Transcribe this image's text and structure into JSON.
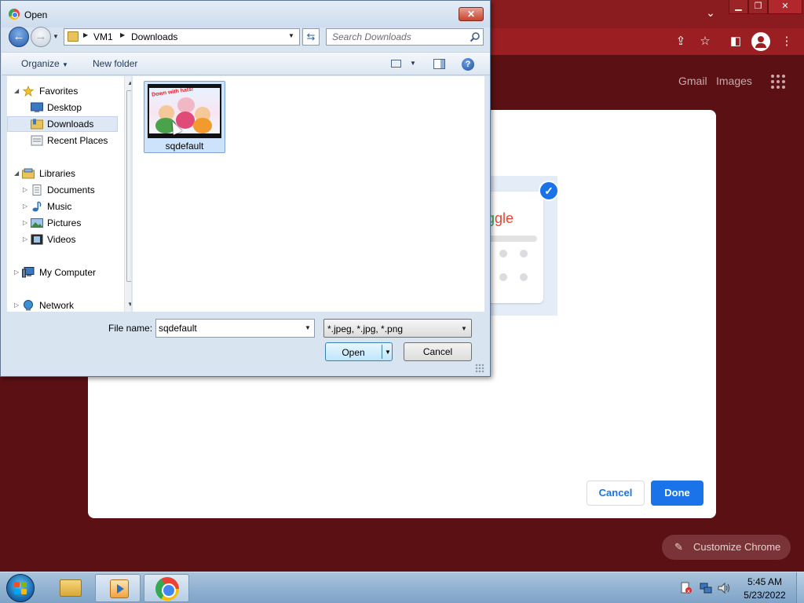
{
  "chrome": {
    "top_links": [
      "Gmail",
      "Images"
    ],
    "customize_button": "Customize Chrome"
  },
  "customize_dialog": {
    "logo_text": "gle",
    "cancel_label": "Cancel",
    "done_label": "Done"
  },
  "open_dialog": {
    "title": "Open",
    "breadcrumb": [
      "VM1",
      "Downloads"
    ],
    "search": {
      "placeholder": "Search Downloads"
    },
    "toolbar": {
      "organize": "Organize",
      "new_folder": "New folder"
    },
    "nav": {
      "items": [
        {
          "label": "Favorites",
          "icon": "star-icon"
        },
        {
          "label": "Desktop",
          "icon": "desktop-icon"
        },
        {
          "label": "Downloads",
          "icon": "downloads-folder-icon",
          "selected": true
        },
        {
          "label": "Recent Places",
          "icon": "recent-places-icon"
        },
        {
          "label": "Libraries",
          "icon": "libraries-icon"
        },
        {
          "label": "Documents",
          "icon": "documents-icon"
        },
        {
          "label": "Music",
          "icon": "music-icon"
        },
        {
          "label": "Pictures",
          "icon": "pictures-icon"
        },
        {
          "label": "Videos",
          "icon": "videos-icon"
        },
        {
          "label": "My Computer",
          "icon": "computer-icon"
        },
        {
          "label": "Network",
          "icon": "network-icon"
        }
      ]
    },
    "files": [
      {
        "name": "sqdefault",
        "thumb_text": "Down with hats!",
        "selected": true
      }
    ],
    "file_name_label": "File name:",
    "file_name_value": "sqdefault",
    "file_type_value": "*.jpeg, *.jpg, *.png",
    "open_label": "Open",
    "cancel_label": "Cancel"
  },
  "taskbar": {
    "time": "5:45 AM",
    "date": "5/23/2022"
  },
  "colors": {
    "chrome_frame": "#8a1c1f",
    "chrome_toolbar": "#9b1f22",
    "page_background": "#5b1114",
    "accent_blue": "#1a73e8",
    "selection_blue": "#cde3fb"
  }
}
